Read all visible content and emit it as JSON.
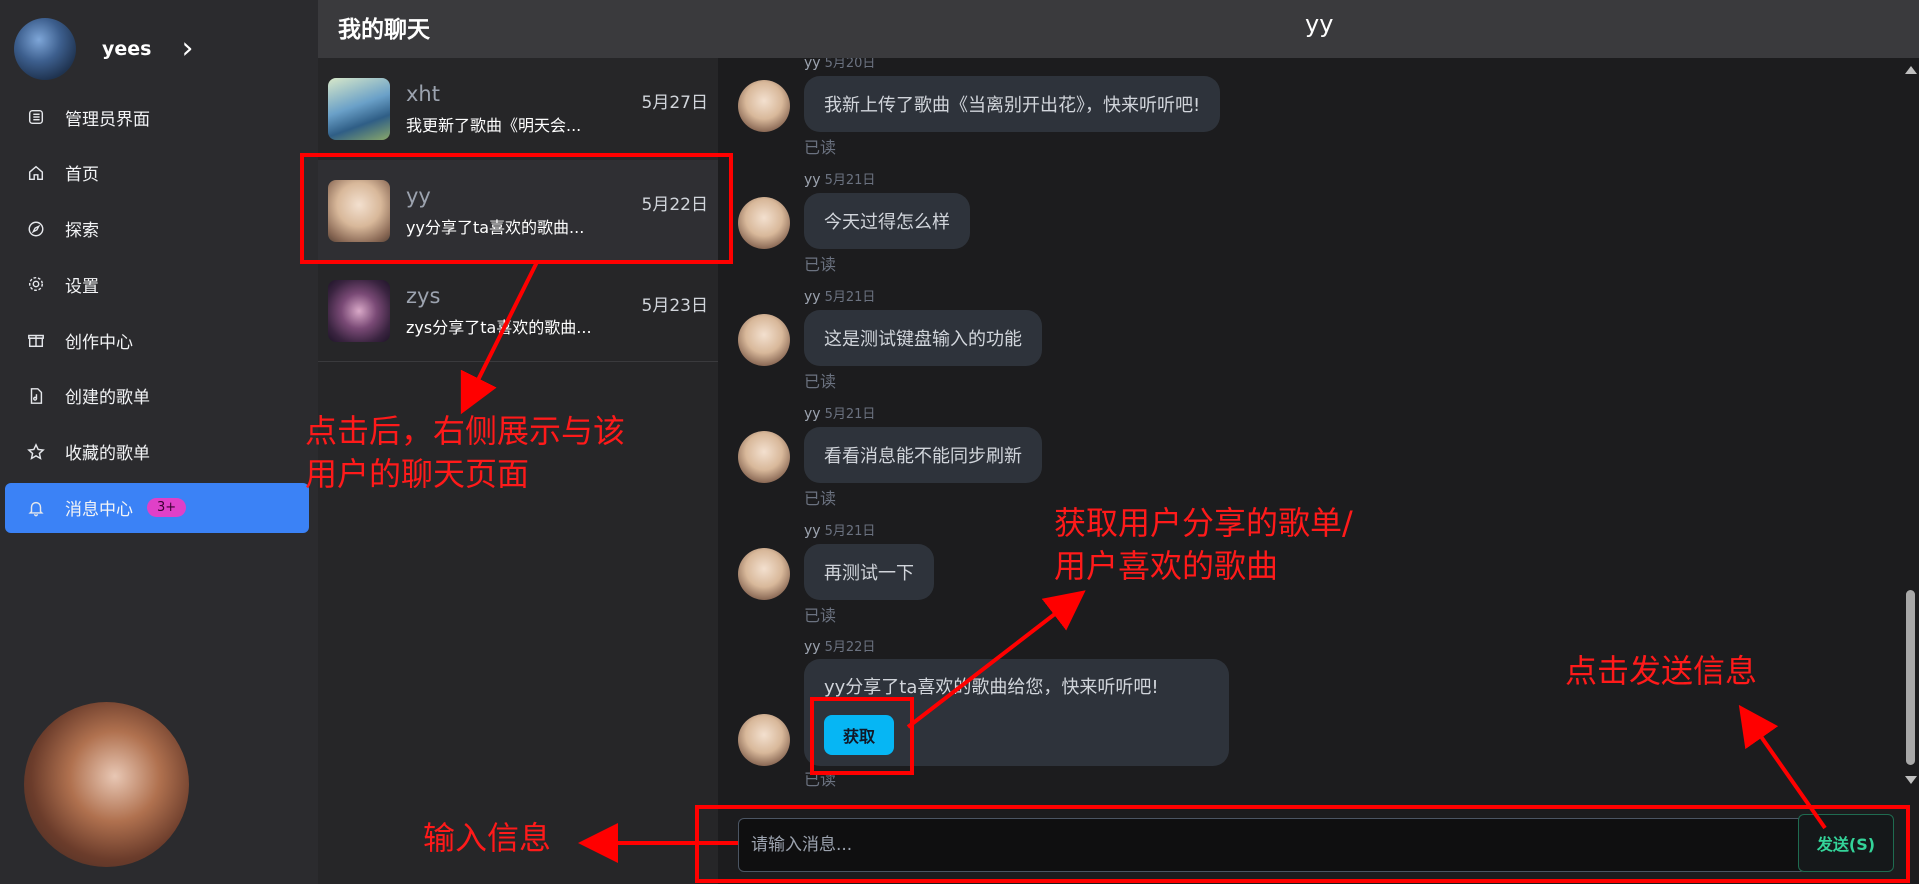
{
  "sidebar": {
    "username": "yees",
    "items": [
      {
        "label": "管理员界面",
        "icon": "admin-list-icon"
      },
      {
        "label": "首页",
        "icon": "home-icon"
      },
      {
        "label": "探索",
        "icon": "compass-icon"
      },
      {
        "label": "设置",
        "icon": "gear-icon"
      },
      {
        "label": "创作中心",
        "icon": "gift-icon"
      },
      {
        "label": "创建的歌单",
        "icon": "music-file-icon"
      },
      {
        "label": "收藏的歌单",
        "icon": "star-icon"
      },
      {
        "label": "消息中心",
        "icon": "bell-icon",
        "badge": "3+",
        "active": true
      }
    ]
  },
  "header": {
    "title": "我的聊天",
    "peer": "yy"
  },
  "chats": [
    {
      "name": "xht",
      "preview": "我更新了歌曲《明天会...",
      "date": "5月27日"
    },
    {
      "name": "yy",
      "preview": "yy分享了ta喜欢的歌曲...",
      "date": "5月22日",
      "selected": true
    },
    {
      "name": "zys",
      "preview": "zys分享了ta喜欢的歌曲...",
      "date": "5月23日"
    }
  ],
  "messages": [
    {
      "sender": "yy",
      "time": "5月20日",
      "text": "我新上传了歌曲《当离别开出花》，快来听听吧!",
      "status": "已读"
    },
    {
      "sender": "yy",
      "time": "5月21日",
      "text": "今天过得怎么样",
      "status": "已读"
    },
    {
      "sender": "yy",
      "time": "5月21日",
      "text": "这是测试键盘输入的功能",
      "status": "已读"
    },
    {
      "sender": "yy",
      "time": "5月21日",
      "text": "看看消息能不能同步刷新",
      "status": "已读"
    },
    {
      "sender": "yy",
      "time": "5月21日",
      "text": "再测试一下",
      "status": "已读"
    }
  ],
  "share_message": {
    "sender": "yy",
    "time": "5月22日",
    "text": "yy分享了ta喜欢的歌曲给您，快来听听吧!",
    "button": "获取",
    "status": "已读"
  },
  "input": {
    "placeholder": "请输入消息...",
    "value": "",
    "send_label": "发送(S)"
  },
  "annotations": {
    "click_chat": "点击后，右侧展示与该\n用户的聊天页面",
    "get_share": "获取用户分享的歌单/\n用户喜欢的歌曲",
    "click_send": "点击发送信息",
    "input_msg": "输入信息"
  },
  "colors": {
    "accent": "#3b82f6",
    "badge": "#e040c8",
    "get_button": "#06b6f4",
    "send_text": "#34d399",
    "annotation": "#ff0000"
  }
}
